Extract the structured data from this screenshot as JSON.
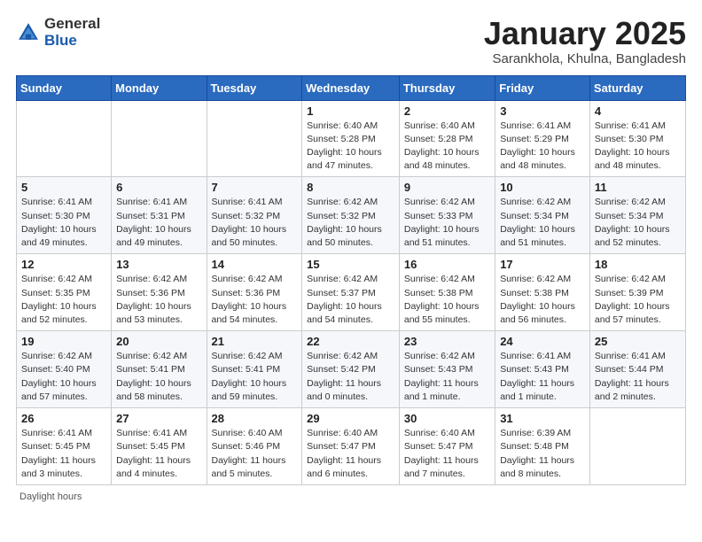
{
  "logo": {
    "general": "General",
    "blue": "Blue"
  },
  "header": {
    "month": "January 2025",
    "location": "Sarankhola, Khulna, Bangladesh"
  },
  "weekdays": [
    "Sunday",
    "Monday",
    "Tuesday",
    "Wednesday",
    "Thursday",
    "Friday",
    "Saturday"
  ],
  "weeks": [
    [
      {
        "day": "",
        "info": ""
      },
      {
        "day": "",
        "info": ""
      },
      {
        "day": "",
        "info": ""
      },
      {
        "day": "1",
        "info": "Sunrise: 6:40 AM\nSunset: 5:28 PM\nDaylight: 10 hours\nand 47 minutes."
      },
      {
        "day": "2",
        "info": "Sunrise: 6:40 AM\nSunset: 5:28 PM\nDaylight: 10 hours\nand 48 minutes."
      },
      {
        "day": "3",
        "info": "Sunrise: 6:41 AM\nSunset: 5:29 PM\nDaylight: 10 hours\nand 48 minutes."
      },
      {
        "day": "4",
        "info": "Sunrise: 6:41 AM\nSunset: 5:30 PM\nDaylight: 10 hours\nand 48 minutes."
      }
    ],
    [
      {
        "day": "5",
        "info": "Sunrise: 6:41 AM\nSunset: 5:30 PM\nDaylight: 10 hours\nand 49 minutes."
      },
      {
        "day": "6",
        "info": "Sunrise: 6:41 AM\nSunset: 5:31 PM\nDaylight: 10 hours\nand 49 minutes."
      },
      {
        "day": "7",
        "info": "Sunrise: 6:41 AM\nSunset: 5:32 PM\nDaylight: 10 hours\nand 50 minutes."
      },
      {
        "day": "8",
        "info": "Sunrise: 6:42 AM\nSunset: 5:32 PM\nDaylight: 10 hours\nand 50 minutes."
      },
      {
        "day": "9",
        "info": "Sunrise: 6:42 AM\nSunset: 5:33 PM\nDaylight: 10 hours\nand 51 minutes."
      },
      {
        "day": "10",
        "info": "Sunrise: 6:42 AM\nSunset: 5:34 PM\nDaylight: 10 hours\nand 51 minutes."
      },
      {
        "day": "11",
        "info": "Sunrise: 6:42 AM\nSunset: 5:34 PM\nDaylight: 10 hours\nand 52 minutes."
      }
    ],
    [
      {
        "day": "12",
        "info": "Sunrise: 6:42 AM\nSunset: 5:35 PM\nDaylight: 10 hours\nand 52 minutes."
      },
      {
        "day": "13",
        "info": "Sunrise: 6:42 AM\nSunset: 5:36 PM\nDaylight: 10 hours\nand 53 minutes."
      },
      {
        "day": "14",
        "info": "Sunrise: 6:42 AM\nSunset: 5:36 PM\nDaylight: 10 hours\nand 54 minutes."
      },
      {
        "day": "15",
        "info": "Sunrise: 6:42 AM\nSunset: 5:37 PM\nDaylight: 10 hours\nand 54 minutes."
      },
      {
        "day": "16",
        "info": "Sunrise: 6:42 AM\nSunset: 5:38 PM\nDaylight: 10 hours\nand 55 minutes."
      },
      {
        "day": "17",
        "info": "Sunrise: 6:42 AM\nSunset: 5:38 PM\nDaylight: 10 hours\nand 56 minutes."
      },
      {
        "day": "18",
        "info": "Sunrise: 6:42 AM\nSunset: 5:39 PM\nDaylight: 10 hours\nand 57 minutes."
      }
    ],
    [
      {
        "day": "19",
        "info": "Sunrise: 6:42 AM\nSunset: 5:40 PM\nDaylight: 10 hours\nand 57 minutes."
      },
      {
        "day": "20",
        "info": "Sunrise: 6:42 AM\nSunset: 5:41 PM\nDaylight: 10 hours\nand 58 minutes."
      },
      {
        "day": "21",
        "info": "Sunrise: 6:42 AM\nSunset: 5:41 PM\nDaylight: 10 hours\nand 59 minutes."
      },
      {
        "day": "22",
        "info": "Sunrise: 6:42 AM\nSunset: 5:42 PM\nDaylight: 11 hours\nand 0 minutes."
      },
      {
        "day": "23",
        "info": "Sunrise: 6:42 AM\nSunset: 5:43 PM\nDaylight: 11 hours\nand 1 minute."
      },
      {
        "day": "24",
        "info": "Sunrise: 6:41 AM\nSunset: 5:43 PM\nDaylight: 11 hours\nand 1 minute."
      },
      {
        "day": "25",
        "info": "Sunrise: 6:41 AM\nSunset: 5:44 PM\nDaylight: 11 hours\nand 2 minutes."
      }
    ],
    [
      {
        "day": "26",
        "info": "Sunrise: 6:41 AM\nSunset: 5:45 PM\nDaylight: 11 hours\nand 3 minutes."
      },
      {
        "day": "27",
        "info": "Sunrise: 6:41 AM\nSunset: 5:45 PM\nDaylight: 11 hours\nand 4 minutes."
      },
      {
        "day": "28",
        "info": "Sunrise: 6:40 AM\nSunset: 5:46 PM\nDaylight: 11 hours\nand 5 minutes."
      },
      {
        "day": "29",
        "info": "Sunrise: 6:40 AM\nSunset: 5:47 PM\nDaylight: 11 hours\nand 6 minutes."
      },
      {
        "day": "30",
        "info": "Sunrise: 6:40 AM\nSunset: 5:47 PM\nDaylight: 11 hours\nand 7 minutes."
      },
      {
        "day": "31",
        "info": "Sunrise: 6:39 AM\nSunset: 5:48 PM\nDaylight: 11 hours\nand 8 minutes."
      },
      {
        "day": "",
        "info": ""
      }
    ]
  ],
  "footer": {
    "daylight_label": "Daylight hours"
  }
}
